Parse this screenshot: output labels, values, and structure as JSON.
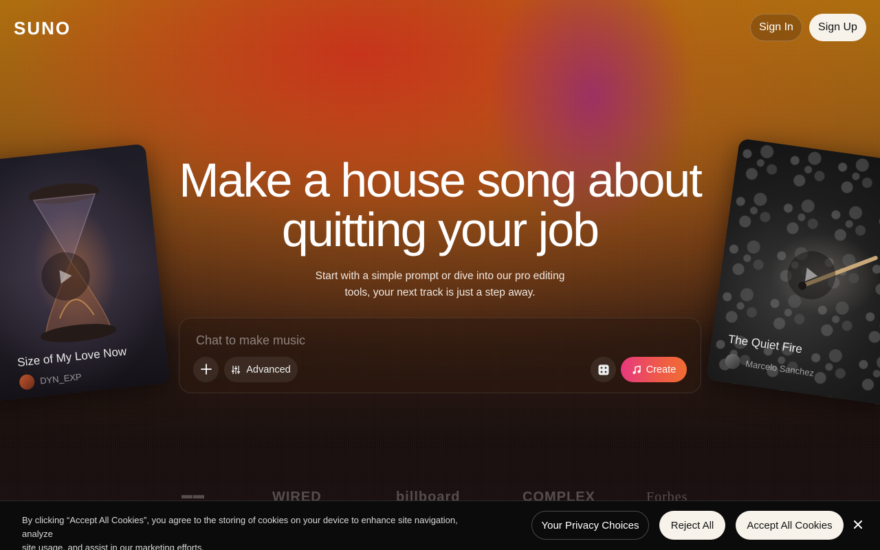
{
  "header": {
    "logo": "SUNO",
    "sign_in": "Sign In",
    "sign_up": "Sign Up"
  },
  "hero": {
    "title_line1": "Make a house song about",
    "title_line2": "quitting your job",
    "subtitle_line1": "Start with a simple prompt or dive into our pro editing",
    "subtitle_line2": "tools, your next track is just a step away."
  },
  "composer": {
    "placeholder": "Chat to make music",
    "advanced_label": "Advanced",
    "create_label": "Create",
    "icons": {
      "add": "plus-icon",
      "advanced": "sliders-icon",
      "random": "dice-icon",
      "create": "music-note-icon"
    },
    "accent_gradient": [
      "#e6397e",
      "#f06d33"
    ]
  },
  "featured_songs": [
    {
      "title": "Size of My Love Now",
      "artist": "DYN_EXP"
    },
    {
      "title": "The Quiet Fire",
      "artist": "Marcelo Sanchez"
    }
  ],
  "press_logos": [
    "WIRED",
    "billboard",
    "COMPLEX",
    "Forbes"
  ],
  "cookie_banner": {
    "text_line1": "By clicking “Accept All Cookies”, you agree to the storing of cookies on your device to enhance site navigation, analyze",
    "text_line2": "site usage, and assist in our marketing efforts.",
    "privacy_choices": "Your Privacy Choices",
    "reject_all": "Reject All",
    "accept_all": "Accept All Cookies"
  }
}
